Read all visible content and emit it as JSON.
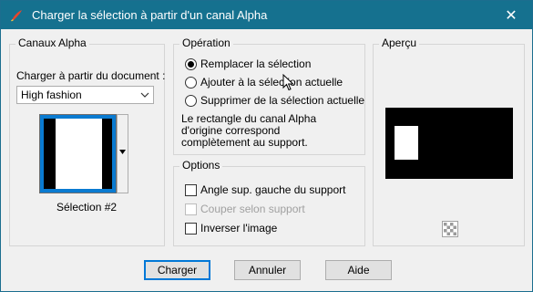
{
  "window": {
    "title": "Charger la sélection à partir d'un canal Alpha",
    "close_glyph": "✕"
  },
  "alpha_channels": {
    "legend": "Canaux Alpha",
    "load_from_label": "Charger à partir du document :",
    "document_value": "High fashion",
    "channel_name": "Sélection #2"
  },
  "operation": {
    "legend": "Opération",
    "options": [
      {
        "label": "Remplacer la sélection",
        "checked": true
      },
      {
        "label": "Ajouter à la sélection actuelle",
        "checked": false
      },
      {
        "label": "Supprimer de la sélection actuelle",
        "checked": false
      }
    ],
    "description_lines": [
      "Le rectangle du canal Alpha",
      "d'origine correspond",
      "complètement au support."
    ]
  },
  "options": {
    "legend": "Options",
    "items": [
      {
        "label": "Angle sup. gauche du support",
        "checked": false,
        "enabled": true
      },
      {
        "label": "Couper selon support",
        "checked": false,
        "enabled": false
      },
      {
        "label": "Inverser l'image",
        "checked": false,
        "enabled": true
      }
    ]
  },
  "preview": {
    "legend": "Aperçu",
    "canvas_color": "#000000",
    "selection_color": "#ffffff"
  },
  "buttons": {
    "ok": "Charger",
    "cancel": "Annuler",
    "help": "Aide"
  },
  "colors": {
    "titlebar": "#15718f",
    "default_button_border": "#0078d7"
  },
  "icons": {
    "app": "paint-brush-icon",
    "close": "close-icon",
    "dropdown": "chevron-down-icon",
    "thumbnail_menu": "triangle-down-icon",
    "zoom": "checker-zoom-icon",
    "cursor": "mouse-pointer-icon"
  }
}
